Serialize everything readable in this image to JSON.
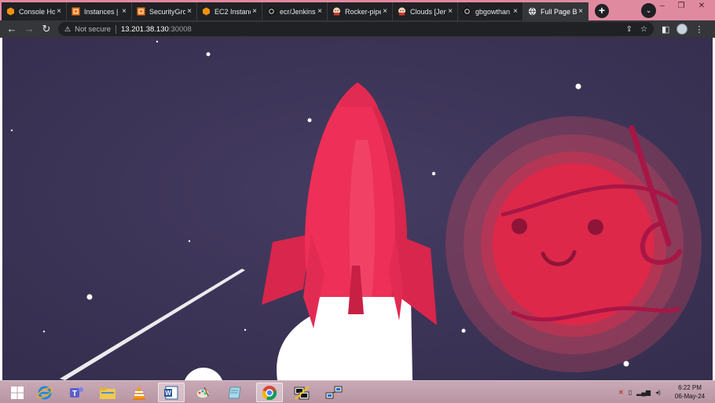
{
  "browser": {
    "tabs": [
      {
        "title": "Console Ho",
        "icon": "aws-icon"
      },
      {
        "title": "Instances |",
        "icon": "aws-ec2-icon"
      },
      {
        "title": "SecurityGro",
        "icon": "aws-ec2-icon"
      },
      {
        "title": "EC2 Instanc",
        "icon": "aws-icon"
      },
      {
        "title": "ecr/Jenkins",
        "icon": "github-icon"
      },
      {
        "title": "Rocker-pipe",
        "icon": "jenkins-icon"
      },
      {
        "title": "Clouds [Jen",
        "icon": "jenkins-icon"
      },
      {
        "title": "gbgowthan",
        "icon": "github-icon"
      },
      {
        "title": "Full Page B",
        "icon": "globe-icon"
      }
    ],
    "close_glyph": "×",
    "new_tab_glyph": "+",
    "tab_search_glyph": "⌄",
    "window_controls": {
      "minimize": "–",
      "maximize": "❐",
      "close": "✕"
    },
    "nav": {
      "back": "←",
      "forward": "→",
      "reload": "↻"
    },
    "omnibox": {
      "warning_glyph": "⚠",
      "security_label": "Not secure",
      "url_host": "13.201.38.130",
      "url_port": ":30008",
      "share_glyph": "⇪",
      "bookmark_glyph": "☆"
    },
    "toolbar_right": {
      "sidepanel_glyph": "◧",
      "menu_glyph": "⋮"
    }
  },
  "taskbar": {
    "apps": [
      {
        "name": "start-button",
        "icon": "windows-logo-icon"
      },
      {
        "name": "internet-explorer",
        "icon": "ie-icon"
      },
      {
        "name": "teams",
        "icon": "teams-icon"
      },
      {
        "name": "file-explorer",
        "icon": "folder-icon"
      },
      {
        "name": "vlc",
        "icon": "vlc-icon"
      },
      {
        "name": "word",
        "icon": "word-icon"
      },
      {
        "name": "paint",
        "icon": "paint-icon"
      },
      {
        "name": "notepad",
        "icon": "notebook-icon"
      },
      {
        "name": "chrome",
        "icon": "chrome-icon"
      },
      {
        "name": "putty",
        "icon": "putty-icon"
      },
      {
        "name": "network-tool",
        "icon": "network-icon"
      }
    ],
    "clock_time": "6:22 PM",
    "clock_date": "06-May-24"
  },
  "colors": {
    "space_bg": "#3d3558",
    "rocket_red": "#ee2f57",
    "rocket_dark": "#d8264c",
    "planet_red": "#dd2849",
    "planet_line": "#a81646",
    "smoke": "#ffffff",
    "tabbar_accent": "#e08aa0"
  }
}
